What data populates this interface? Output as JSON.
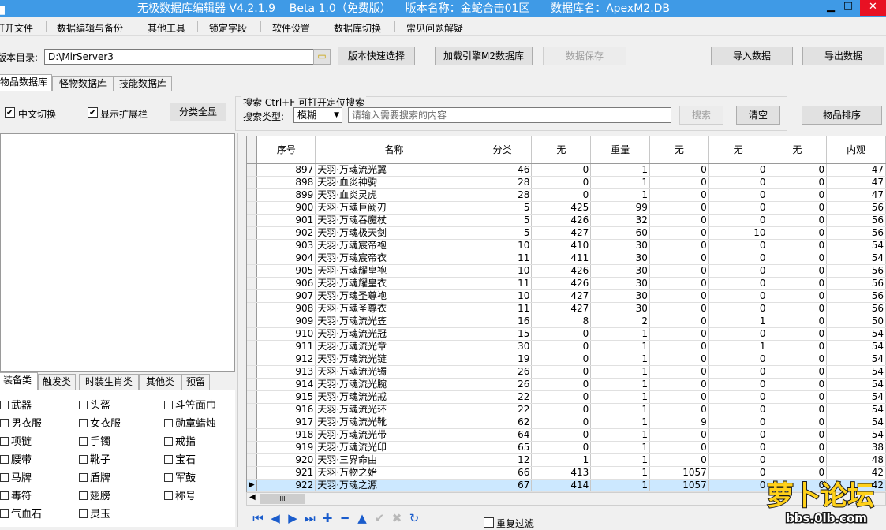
{
  "window": {
    "title": "无极数据库编辑器 V4.2.1.9    Beta 1.0（免费版）    版本名称：金蛇合击01区      数据库名：ApexM2.DB"
  },
  "menu": [
    "打开文件",
    "数据编辑与备份",
    "其他工具",
    "锁定字段",
    "软件设置",
    "数据库切换",
    "常见问题解疑"
  ],
  "toolbar": {
    "dir_label": "版本目录:",
    "dir_value": "D:\\MirServer3",
    "quick_select": "版本快速选择",
    "load_engine": "加载引擎M2数据库",
    "save": "数据保存",
    "import": "导入数据",
    "export": "导出数据"
  },
  "db_tabs": [
    "物品数据库",
    "怪物数据库",
    "技能数据库"
  ],
  "options": {
    "cn_toggle": "中文切换",
    "show_ext": "显示扩展栏",
    "classify_all": "分类全显",
    "search_label": "搜索   Ctrl+F 可打开定位搜索",
    "search_type_label": "搜索类型:",
    "search_type_value": "模糊",
    "search_placeholder": "请输入需要搜索的内容",
    "search_button": "搜索",
    "clear_button": "清空",
    "sort_button": "物品排序"
  },
  "grid": {
    "columns": [
      "序号",
      "名称",
      "分类",
      "无",
      "重量",
      "无",
      "无",
      "无",
      "内观"
    ],
    "rows": [
      [
        "897",
        "天羽·万魂流光翼",
        "46",
        "0",
        "1",
        "0",
        "0",
        "0",
        "47"
      ],
      [
        "898",
        "天羽·血炎神驹",
        "28",
        "0",
        "1",
        "0",
        "0",
        "0",
        "47"
      ],
      [
        "899",
        "天羽·血炎灵虎",
        "28",
        "0",
        "1",
        "0",
        "0",
        "0",
        "47"
      ],
      [
        "900",
        "天羽·万魂巨阙刃",
        "5",
        "425",
        "99",
        "0",
        "0",
        "0",
        "56"
      ],
      [
        "901",
        "天羽·万魂吞魔杖",
        "5",
        "426",
        "32",
        "0",
        "0",
        "0",
        "56"
      ],
      [
        "902",
        "天羽·万魂极天剑",
        "5",
        "427",
        "60",
        "0",
        "-10",
        "0",
        "56"
      ],
      [
        "903",
        "天羽·万魂宸帝袍",
        "10",
        "410",
        "30",
        "0",
        "0",
        "0",
        "54"
      ],
      [
        "904",
        "天羽·万魂宸帝衣",
        "11",
        "411",
        "30",
        "0",
        "0",
        "0",
        "54"
      ],
      [
        "905",
        "天羽·万魂耀皇袍",
        "10",
        "426",
        "30",
        "0",
        "0",
        "0",
        "56"
      ],
      [
        "906",
        "天羽·万魂耀皇衣",
        "11",
        "426",
        "30",
        "0",
        "0",
        "0",
        "56"
      ],
      [
        "907",
        "天羽·万魂圣尊袍",
        "10",
        "427",
        "30",
        "0",
        "0",
        "0",
        "56"
      ],
      [
        "908",
        "天羽·万魂圣尊衣",
        "11",
        "427",
        "30",
        "0",
        "0",
        "0",
        "56"
      ],
      [
        "909",
        "天羽·万魂流光笠",
        "16",
        "8",
        "2",
        "0",
        "1",
        "0",
        "50"
      ],
      [
        "910",
        "天羽·万魂流光冠",
        "15",
        "0",
        "1",
        "0",
        "0",
        "0",
        "54"
      ],
      [
        "911",
        "天羽·万魂流光章",
        "30",
        "0",
        "1",
        "0",
        "1",
        "0",
        "54"
      ],
      [
        "912",
        "天羽·万魂流光链",
        "19",
        "0",
        "1",
        "0",
        "0",
        "0",
        "54"
      ],
      [
        "913",
        "天羽·万魂流光镯",
        "26",
        "0",
        "1",
        "0",
        "0",
        "0",
        "54"
      ],
      [
        "914",
        "天羽·万魂流光腕",
        "26",
        "0",
        "1",
        "0",
        "0",
        "0",
        "54"
      ],
      [
        "915",
        "天羽·万魂流光戒",
        "22",
        "0",
        "1",
        "0",
        "0",
        "0",
        "54"
      ],
      [
        "916",
        "天羽·万魂流光环",
        "22",
        "0",
        "1",
        "0",
        "0",
        "0",
        "54"
      ],
      [
        "917",
        "天羽·万魂流光靴",
        "62",
        "0",
        "1",
        "9",
        "0",
        "0",
        "54"
      ],
      [
        "918",
        "天羽·万魂流光带",
        "64",
        "0",
        "1",
        "0",
        "0",
        "0",
        "54"
      ],
      [
        "919",
        "天羽·万魂流光印",
        "65",
        "0",
        "1",
        "0",
        "0",
        "0",
        "38"
      ],
      [
        "920",
        "天羽·三界命由",
        "12",
        "1",
        "1",
        "0",
        "0",
        "0",
        "48"
      ],
      [
        "921",
        "天羽·万物之始",
        "66",
        "413",
        "1",
        "1057",
        "0",
        "0",
        "42"
      ],
      [
        "922",
        "天羽·万魂之源",
        "67",
        "414",
        "1",
        "1057",
        "0",
        "0",
        "42"
      ]
    ]
  },
  "category_tabs": [
    "装备类",
    "触发类",
    "时装生肖类",
    "其他类",
    "预留"
  ],
  "categories": [
    "武器",
    "头盔",
    "斗笠面巾",
    "男衣服",
    "女衣服",
    "勋章蜡烛",
    "项链",
    "手镯",
    "戒指",
    "腰带",
    "靴子",
    "宝石",
    "马牌",
    "盾牌",
    "军鼓",
    "毒符",
    "翅膀",
    "称号",
    "气血石",
    "灵玉"
  ],
  "filter": {
    "repeat_filter": "重复过滤"
  },
  "watermark": {
    "brand": "萝卜论坛",
    "url": "bbs.0lb.com"
  }
}
